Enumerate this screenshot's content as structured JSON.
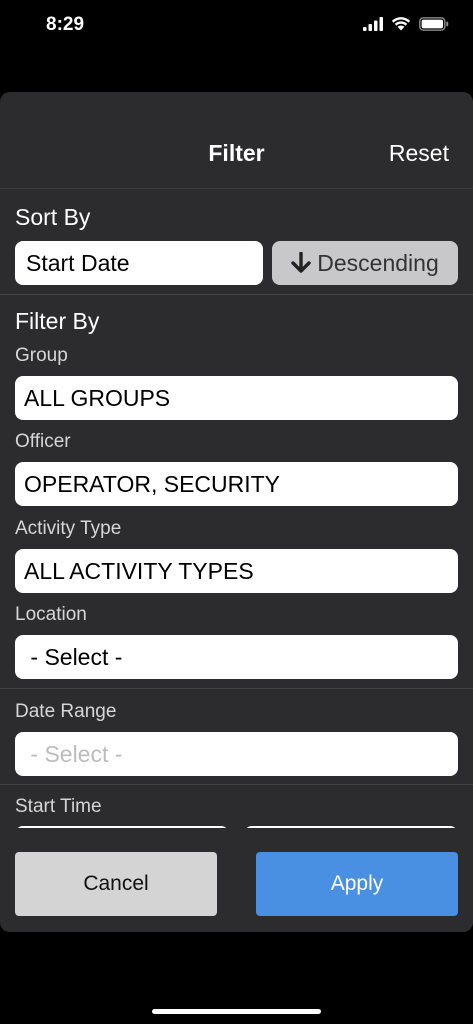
{
  "status_bar": {
    "time": "8:29"
  },
  "header": {
    "title": "Filter",
    "reset_label": "Reset"
  },
  "sort_by": {
    "label": "Sort By",
    "field_value": "Start Date",
    "order_label": "Descending"
  },
  "filter_by": {
    "label": "Filter By",
    "group": {
      "label": "Group",
      "value": "ALL GROUPS"
    },
    "officer": {
      "label": "Officer",
      "value": "OPERATOR, SECURITY"
    },
    "activity_type": {
      "label": "Activity Type",
      "value": "ALL ACTIVITY TYPES"
    },
    "location": {
      "label": "Location",
      "value": " - Select -"
    }
  },
  "date_range": {
    "label": "Date Range",
    "placeholder": " - Select -"
  },
  "start_time": {
    "label": "Start Time"
  },
  "footer": {
    "cancel_label": "Cancel",
    "apply_label": "Apply"
  },
  "colors": {
    "sheet_bg": "#2c2c2e",
    "apply_button": "#4a90e2",
    "cancel_button": "#d4d4d4",
    "sort_order_button": "#c8c8ca"
  }
}
